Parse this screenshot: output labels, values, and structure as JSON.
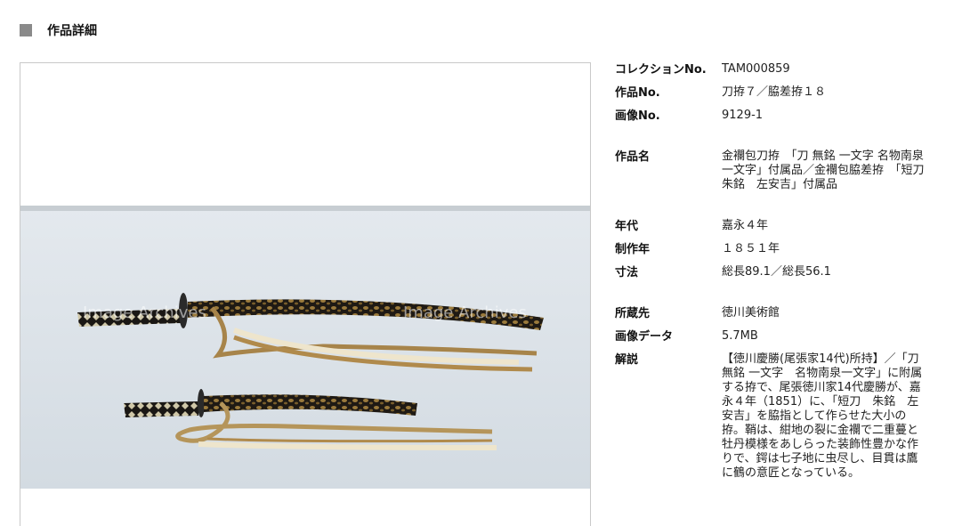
{
  "header": {
    "title": "作品詳細"
  },
  "image": {
    "watermark": "Image Archives"
  },
  "details": [
    {
      "label": "コレクションNo.",
      "value": "TAM000859"
    },
    {
      "label": "作品No.",
      "value": "刀拵７／脇差拵１８"
    },
    {
      "label": "画像No.",
      "value": "9129-1"
    },
    {
      "label": "作品名",
      "value": "金襴包刀拵　「刀 無銘 一文字 名物南泉一文字」付属品／金襴包脇差拵　「短刀　朱銘　左安吉」付属品"
    },
    {
      "label": "年代",
      "value": "嘉永４年"
    },
    {
      "label": "制作年",
      "value": "１８５１年"
    },
    {
      "label": "寸法",
      "value": "総長89.1／総長56.1"
    },
    {
      "label": "所蔵先",
      "value": "徳川美術館"
    },
    {
      "label": "画像データ",
      "value": "5.7MB"
    },
    {
      "label": "解説",
      "value": "【徳川慶勝(尾張家14代)所持】／「刀 無銘 一文字　名物南泉一文字」に附属する拵で、尾張徳川家14代慶勝が、嘉永４年（1851）に、「短刀　朱銘　左安吉」を脇指として作らせた大小の拵。鞘は、紺地の裂に金襴で二重蔓と牡丹模様をあしらった装飾性豊かな作りで、鍔は七子地に虫尽し、目貫は鷹に鶴の意匠となっている。"
    }
  ]
}
